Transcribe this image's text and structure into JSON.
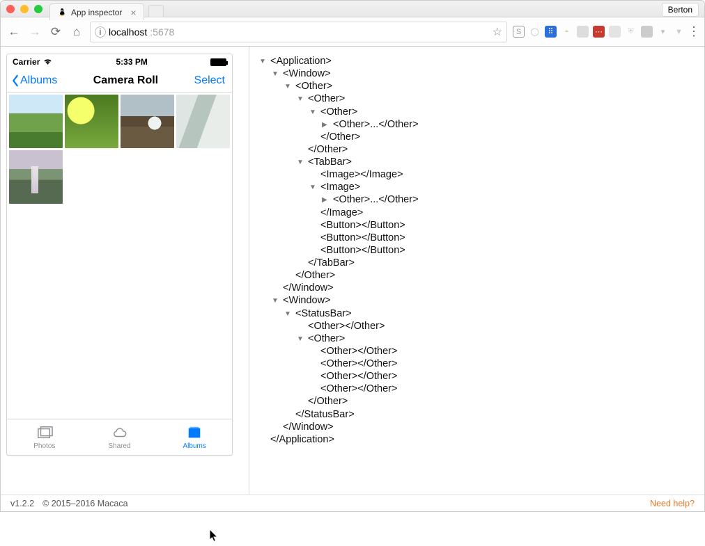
{
  "window": {
    "user": "Berton"
  },
  "tab": {
    "title": "App inspector"
  },
  "address": {
    "host": "localhost",
    "port": ":5678"
  },
  "device": {
    "carrier": "Carrier",
    "time": "5:33 PM",
    "back": "Albums",
    "title": "Camera Roll",
    "action": "Select",
    "tabs": {
      "photos": "Photos",
      "shared": "Shared",
      "albums": "Albums"
    }
  },
  "tree": [
    {
      "ind": 0,
      "tog": "down",
      "txt": "<Application>"
    },
    {
      "ind": 1,
      "tog": "down",
      "txt": "<Window>"
    },
    {
      "ind": 2,
      "tog": "down",
      "txt": "<Other>"
    },
    {
      "ind": 3,
      "tog": "down",
      "txt": "<Other>"
    },
    {
      "ind": 4,
      "tog": "down",
      "txt": "<Other>"
    },
    {
      "ind": 5,
      "tog": "right",
      "txt": "<Other>...</Other>"
    },
    {
      "ind": 4,
      "tog": "",
      "txt": "</Other>"
    },
    {
      "ind": 3,
      "tog": "",
      "txt": "</Other>"
    },
    {
      "ind": 3,
      "tog": "down",
      "txt": "<TabBar>"
    },
    {
      "ind": 4,
      "tog": "",
      "txt": "<Image></Image>"
    },
    {
      "ind": 4,
      "tog": "down",
      "txt": "<Image>"
    },
    {
      "ind": 5,
      "tog": "right",
      "txt": "<Other>...</Other>"
    },
    {
      "ind": 4,
      "tog": "",
      "txt": "</Image>"
    },
    {
      "ind": 4,
      "tog": "",
      "txt": "<Button></Button>"
    },
    {
      "ind": 4,
      "tog": "",
      "txt": "<Button></Button>"
    },
    {
      "ind": 4,
      "tog": "",
      "txt": "<Button></Button>"
    },
    {
      "ind": 3,
      "tog": "",
      "txt": "</TabBar>"
    },
    {
      "ind": 2,
      "tog": "",
      "txt": "</Other>"
    },
    {
      "ind": 1,
      "tog": "",
      "txt": "</Window>"
    },
    {
      "ind": 1,
      "tog": "down",
      "txt": "<Window>"
    },
    {
      "ind": 2,
      "tog": "down",
      "txt": "<StatusBar>"
    },
    {
      "ind": 3,
      "tog": "",
      "txt": "<Other></Other>"
    },
    {
      "ind": 3,
      "tog": "down",
      "txt": "<Other>"
    },
    {
      "ind": 4,
      "tog": "",
      "txt": "<Other></Other>"
    },
    {
      "ind": 4,
      "tog": "",
      "txt": "<Other></Other>"
    },
    {
      "ind": 4,
      "tog": "",
      "txt": "<Other></Other>"
    },
    {
      "ind": 4,
      "tog": "",
      "txt": "<Other></Other>"
    },
    {
      "ind": 3,
      "tog": "",
      "txt": "</Other>"
    },
    {
      "ind": 2,
      "tog": "",
      "txt": "</StatusBar>"
    },
    {
      "ind": 1,
      "tog": "",
      "txt": "</Window>"
    },
    {
      "ind": 0,
      "tog": "",
      "txt": "</Application>"
    }
  ],
  "footer": {
    "version": "v1.2.2",
    "copyright": "© 2015–2016 Macaca",
    "help": "Need help?"
  }
}
